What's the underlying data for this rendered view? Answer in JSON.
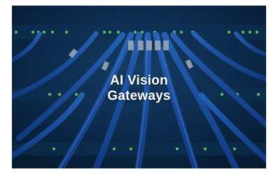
{
  "banner": {
    "title_line_1": "AI Vision",
    "title_line_2": "Gateways",
    "colors": {
      "background": "#0b2a4a",
      "cable": "#1e63c8",
      "cable_highlight": "#4a8ff0",
      "led": "#7cff6a",
      "title": "#ffffff"
    },
    "image_subject": "network-cables-server-rack"
  }
}
